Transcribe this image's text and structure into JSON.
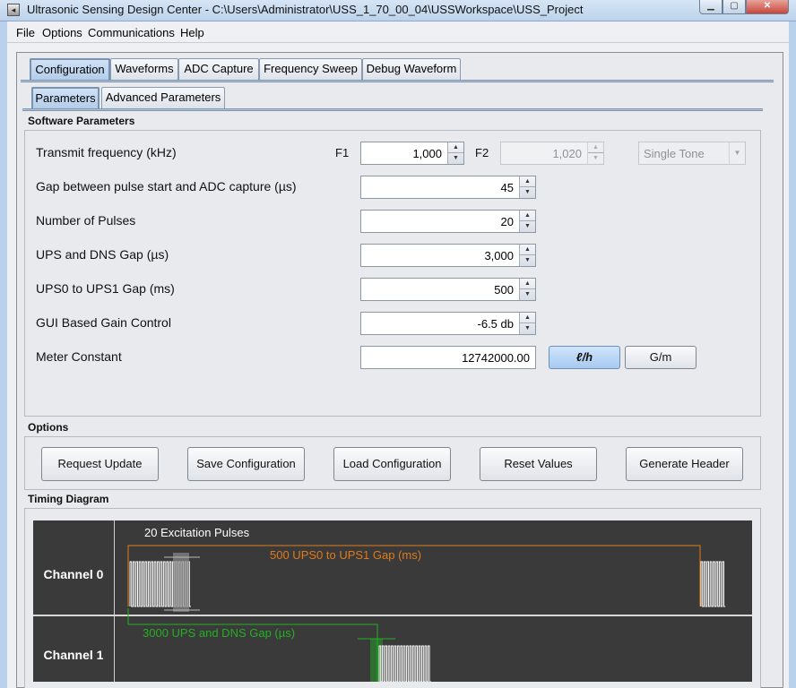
{
  "window": {
    "title": "Ultrasonic Sensing Design Center - C:\\Users\\Administrator\\USS_1_70_00_04\\USSWorkspace\\USS_Project"
  },
  "menu": {
    "file": "File",
    "options": "Options",
    "communications": "Communications",
    "help": "Help"
  },
  "tabs": {
    "main": [
      "Configuration",
      "Waveforms",
      "ADC Capture",
      "Frequency Sweep",
      "Debug Waveform"
    ],
    "sub": [
      "Parameters",
      "Advanced Parameters"
    ]
  },
  "software_parameters": {
    "title": "Software Parameters",
    "transmit_frequency": {
      "label": "Transmit frequency (kHz)",
      "f1_label": "F1",
      "f1_value": "1,000",
      "f2_label": "F2",
      "f2_value": "1,020",
      "mode": "Single Tone"
    },
    "gap_pulse_adc": {
      "label": "Gap between pulse start and ADC capture (µs)",
      "value": "45"
    },
    "num_pulses": {
      "label": "Number of Pulses",
      "value": "20"
    },
    "ups_dns_gap": {
      "label": "UPS and DNS Gap (µs)",
      "value": "3,000"
    },
    "ups0_ups1_gap": {
      "label": "UPS0 to UPS1 Gap (ms)",
      "value": "500"
    },
    "gain_control": {
      "label": "GUI Based Gain Control",
      "value": "-6.5 db"
    },
    "meter_constant": {
      "label": "Meter Constant",
      "value": "12742000.00",
      "unit_lh": "ℓ/h",
      "unit_gm": "G/m"
    }
  },
  "options": {
    "title": "Options",
    "buttons": [
      "Request Update",
      "Save Configuration",
      "Load Configuration",
      "Reset Values",
      "Generate Header"
    ]
  },
  "timing_diagram": {
    "title": "Timing Diagram",
    "channel0": "Channel 0",
    "channel1": "Channel 1",
    "excitation_label": "20 Excitation Pulses",
    "ups0_ups1_label": "500 UPS0 to UPS1 Gap (ms)",
    "ups_dns_label": "3000 UPS and DNS Gap (µs)",
    "colors": {
      "background": "#3a3a3a",
      "orange": "#e07a1a",
      "green": "#22b022",
      "pulse": "#ffffff"
    }
  }
}
